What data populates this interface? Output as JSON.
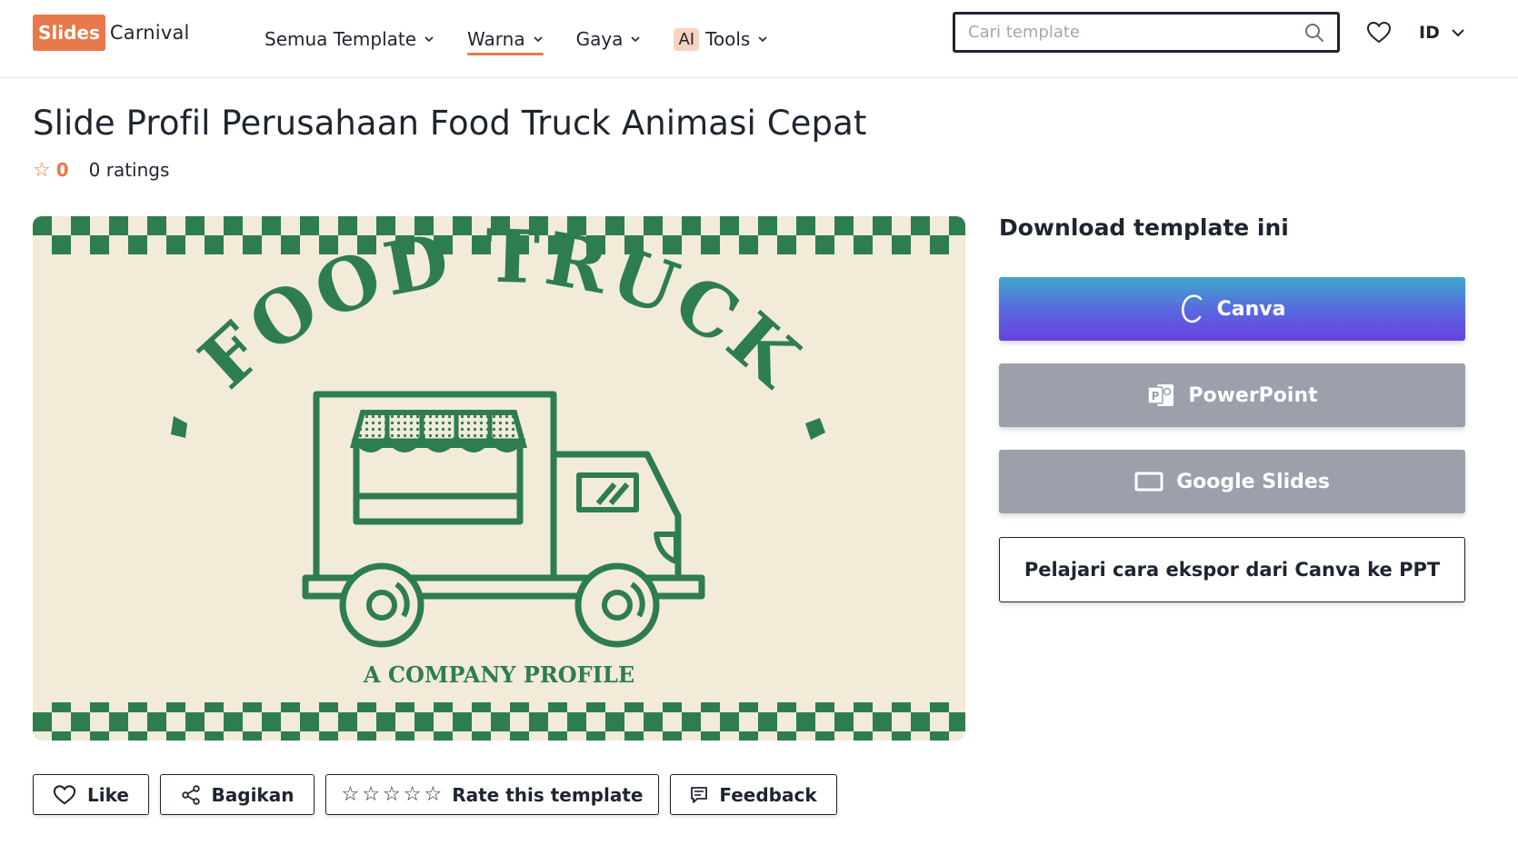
{
  "header": {
    "logo": {
      "box_text": "Slides",
      "text": "Carnival"
    },
    "nav": [
      {
        "label": "Semua Template",
        "active": false
      },
      {
        "label": "Warna",
        "active": true
      },
      {
        "label": "Gaya",
        "active": false
      },
      {
        "badge": "AI",
        "label": "Tools",
        "active": false
      }
    ],
    "search": {
      "placeholder": "Cari template",
      "value": ""
    },
    "language": "ID"
  },
  "page": {
    "title": "Slide Profil Perusahaan Food Truck Animasi Cepat",
    "rating": {
      "value": "0",
      "count_text": "0 ratings"
    }
  },
  "preview": {
    "headline": "FOOD TRUCK",
    "subtitle": "A COMPANY PROFILE",
    "colors": {
      "background": "#f1ebd8",
      "ink": "#2e7d4f"
    }
  },
  "download": {
    "title": "Download template ini",
    "canva_label": "Canva",
    "powerpoint_label": "PowerPoint",
    "google_slides_label": "Google Slides",
    "learn_label": "Pelajari cara ekspor dari Canva ke PPT"
  },
  "actions": {
    "like_label": "Like",
    "share_label": "Bagikan",
    "rate_label": "Rate this template",
    "feedback_label": "Feedback"
  },
  "colors": {
    "accent": "#e8794a",
    "text": "#1f2430",
    "disabled_button": "#9ba0ab"
  }
}
